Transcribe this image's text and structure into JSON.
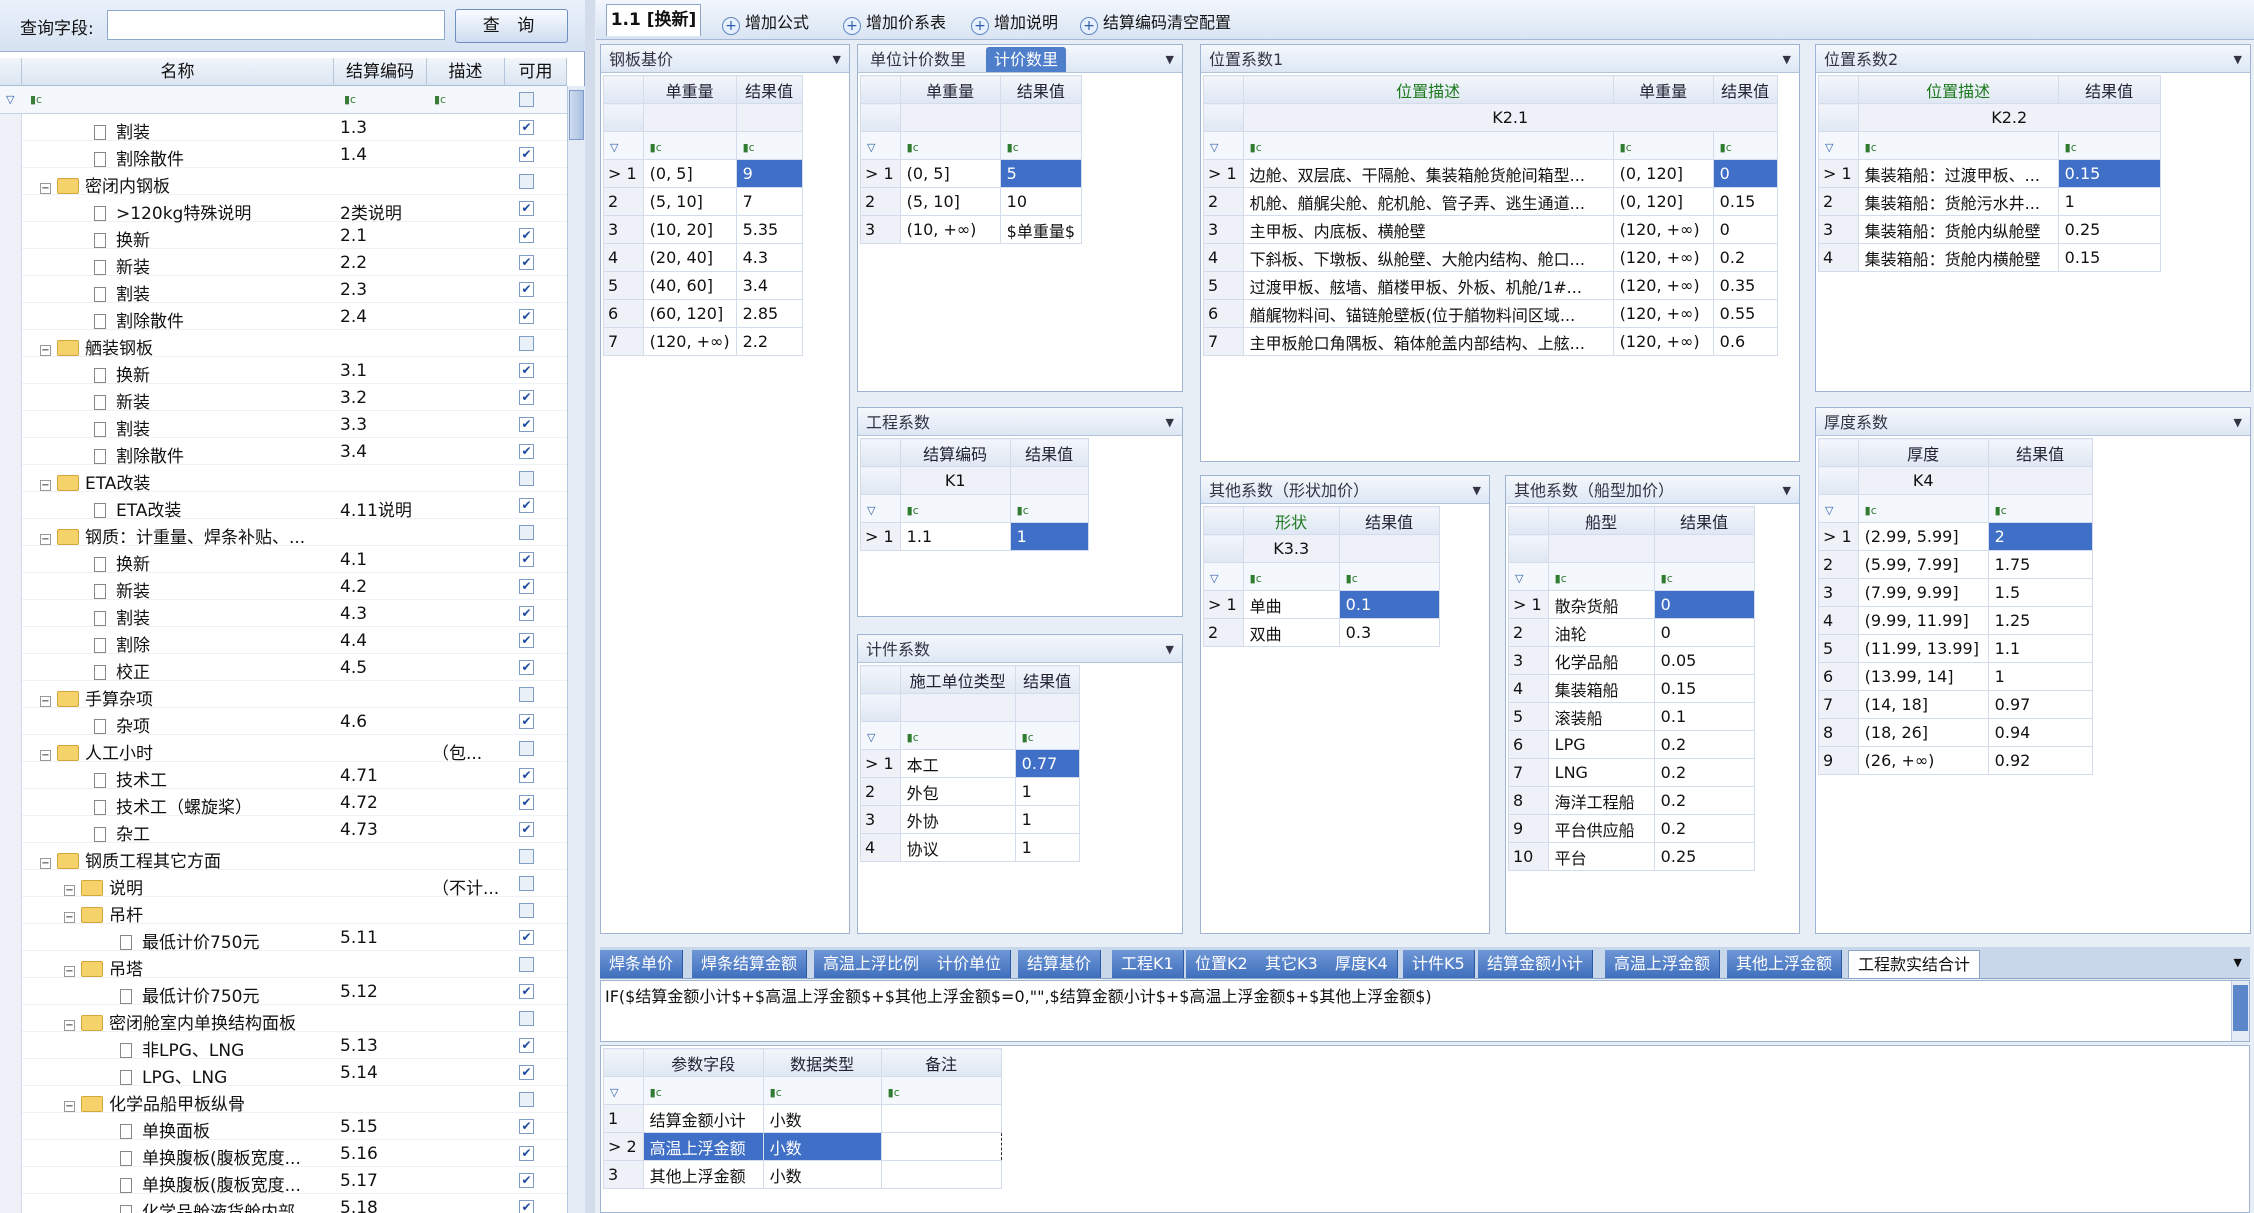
{
  "search": {
    "label": "查询字段:",
    "value": "",
    "button": "查 询"
  },
  "tree": {
    "columns": [
      "名称",
      "结算编码",
      "描述",
      "可用"
    ],
    "filter_icon": "filter-icon",
    "rows": [
      {
        "name": "割装",
        "code": "1.3",
        "desc": "",
        "level": 2,
        "type": "doc",
        "checked": true
      },
      {
        "name": "割除散件",
        "code": "1.4",
        "desc": "",
        "level": 2,
        "type": "doc",
        "checked": true
      },
      {
        "name": "密闭内钢板",
        "code": "",
        "desc": "",
        "level": 1,
        "type": "folder",
        "checked": false
      },
      {
        "name": ">120kg特殊说明",
        "code": "2类说明",
        "desc": "",
        "level": 2,
        "type": "doc",
        "checked": true
      },
      {
        "name": "换新",
        "code": "2.1",
        "desc": "",
        "level": 2,
        "type": "doc",
        "checked": true
      },
      {
        "name": "新装",
        "code": "2.2",
        "desc": "",
        "level": 2,
        "type": "doc",
        "checked": true
      },
      {
        "name": "割装",
        "code": "2.3",
        "desc": "",
        "level": 2,
        "type": "doc",
        "checked": true
      },
      {
        "name": "割除散件",
        "code": "2.4",
        "desc": "",
        "level": 2,
        "type": "doc",
        "checked": true
      },
      {
        "name": "舾装钢板",
        "code": "",
        "desc": "",
        "level": 1,
        "type": "folder",
        "checked": false
      },
      {
        "name": "换新",
        "code": "3.1",
        "desc": "",
        "level": 2,
        "type": "doc",
        "checked": true
      },
      {
        "name": "新装",
        "code": "3.2",
        "desc": "",
        "level": 2,
        "type": "doc",
        "checked": true
      },
      {
        "name": "割装",
        "code": "3.3",
        "desc": "",
        "level": 2,
        "type": "doc",
        "checked": true
      },
      {
        "name": "割除散件",
        "code": "3.4",
        "desc": "",
        "level": 2,
        "type": "doc",
        "checked": true
      },
      {
        "name": "ETA改装",
        "code": "",
        "desc": "",
        "level": 1,
        "type": "folder",
        "checked": false
      },
      {
        "name": "ETA改装",
        "code": "4.11说明",
        "desc": "",
        "level": 2,
        "type": "doc",
        "checked": true
      },
      {
        "name": "钢质：计重量、焊条补贴、...",
        "code": "",
        "desc": "",
        "level": 1,
        "type": "folder",
        "checked": false
      },
      {
        "name": "换新",
        "code": "4.1",
        "desc": "",
        "level": 2,
        "type": "doc",
        "checked": true
      },
      {
        "name": "新装",
        "code": "4.2",
        "desc": "",
        "level": 2,
        "type": "doc",
        "checked": true
      },
      {
        "name": "割装",
        "code": "4.3",
        "desc": "",
        "level": 2,
        "type": "doc",
        "checked": true
      },
      {
        "name": "割除",
        "code": "4.4",
        "desc": "",
        "level": 2,
        "type": "doc",
        "checked": true
      },
      {
        "name": "校正",
        "code": "4.5",
        "desc": "",
        "level": 2,
        "type": "doc",
        "checked": true
      },
      {
        "name": "手算杂项",
        "code": "",
        "desc": "",
        "level": 1,
        "type": "folder",
        "checked": false
      },
      {
        "name": "杂项",
        "code": "4.6",
        "desc": "",
        "level": 2,
        "type": "doc",
        "checked": true
      },
      {
        "name": "人工小时",
        "code": "",
        "desc": "（包...",
        "level": 1,
        "type": "folder",
        "checked": false
      },
      {
        "name": "技术工",
        "code": "4.71",
        "desc": "",
        "level": 2,
        "type": "doc",
        "checked": true
      },
      {
        "name": "技术工（螺旋桨）",
        "code": "4.72",
        "desc": "",
        "level": 2,
        "type": "doc",
        "checked": true
      },
      {
        "name": "杂工",
        "code": "4.73",
        "desc": "",
        "level": 2,
        "type": "doc",
        "checked": true
      },
      {
        "name": "钢质工程其它方面",
        "code": "",
        "desc": "",
        "level": 1,
        "type": "folder",
        "checked": false
      },
      {
        "name": "说明",
        "code": "",
        "desc": "（不计...",
        "level": 2,
        "type": "folder",
        "checked": false
      },
      {
        "name": "吊杆",
        "code": "",
        "desc": "",
        "level": 2,
        "type": "folder",
        "checked": false
      },
      {
        "name": "最低计价750元",
        "code": "5.11",
        "desc": "",
        "level": 3,
        "type": "doc",
        "checked": true
      },
      {
        "name": "吊塔",
        "code": "",
        "desc": "",
        "level": 2,
        "type": "folder",
        "checked": false
      },
      {
        "name": "最低计价750元",
        "code": "5.12",
        "desc": "",
        "level": 3,
        "type": "doc",
        "checked": true
      },
      {
        "name": "密闭舱室内单换结构面板",
        "code": "",
        "desc": "",
        "level": 2,
        "type": "folder",
        "checked": false
      },
      {
        "name": "非LPG、LNG",
        "code": "5.13",
        "desc": "",
        "level": 3,
        "type": "doc",
        "checked": true
      },
      {
        "name": "LPG、LNG",
        "code": "5.14",
        "desc": "",
        "level": 3,
        "type": "doc",
        "checked": true
      },
      {
        "name": "化学品船甲板纵骨",
        "code": "",
        "desc": "",
        "level": 2,
        "type": "folder",
        "checked": false
      },
      {
        "name": "单换面板",
        "code": "5.15",
        "desc": "",
        "level": 3,
        "type": "doc",
        "checked": true
      },
      {
        "name": "单换腹板(腹板宽度...",
        "code": "5.16",
        "desc": "",
        "level": 3,
        "type": "doc",
        "checked": true
      },
      {
        "name": "单换腹板(腹板宽度...",
        "code": "5.17",
        "desc": "",
        "level": 3,
        "type": "doc",
        "checked": true
      },
      {
        "name": "化学品舱液货舱内部...",
        "code": "5.18",
        "desc": "",
        "level": 3,
        "type": "doc",
        "checked": true
      }
    ]
  },
  "toolbar": {
    "active_tab": "1.1 [换新]",
    "buttons": [
      "增加公式",
      "增加价系表",
      "增加说明",
      "结算编码清空配置"
    ]
  },
  "panels": {
    "steel_base": {
      "title": "钢板基价",
      "headers": [
        "单重量",
        "结果值"
      ],
      "rows": [
        [
          "(0, 5]",
          "9"
        ],
        [
          "(5, 10]",
          "7"
        ],
        [
          "(10, 20]",
          "5.35"
        ],
        [
          "(20, 40]",
          "4.3"
        ],
        [
          "(40, 60]",
          "3.4"
        ],
        [
          "(60, 120]",
          "2.85"
        ],
        [
          "(120, +∞)",
          "2.2"
        ]
      ]
    },
    "unit_qty": {
      "tabs": [
        "单位计价数里",
        "计价数里"
      ],
      "headers": [
        "单重量",
        "结果值"
      ],
      "rows": [
        [
          "(0, 5]",
          "5"
        ],
        [
          "(5, 10]",
          "10"
        ],
        [
          "(10, +∞)",
          "$单重量$"
        ]
      ]
    },
    "pos1": {
      "title": "位置系数1",
      "headers": [
        "位置描述",
        "单重量",
        "结果值"
      ],
      "key": "K2.1",
      "rows": [
        [
          "边舱、双层底、干隔舱、集装箱舱货舱间箱型...",
          "(0, 120]",
          "0"
        ],
        [
          "机舱、艏艉尖舱、舵机舱、管子弄、逃生通道...",
          "(0, 120]",
          "0.15"
        ],
        [
          "主甲板、内底板、横舱壁",
          "(120, +∞)",
          "0"
        ],
        [
          "下斜板、下墩板、纵舱壁、大舱内结构、舱口...",
          "(120, +∞)",
          "0.2"
        ],
        [
          "过渡甲板、舷墙、艏楼甲板、外板、机舱/1#...",
          "(120, +∞)",
          "0.35"
        ],
        [
          "艏艉物料间、锚链舱壁板(位于艏物料间区域...",
          "(120, +∞)",
          "0.55"
        ],
        [
          "主甲板舱口角隅板、箱体舱盖内部结构、上舷...",
          "(120, +∞)",
          "0.6"
        ]
      ]
    },
    "pos2": {
      "title": "位置系数2",
      "headers": [
        "位置描述",
        "结果值"
      ],
      "key": "K2.2",
      "rows": [
        [
          "集装箱船：过渡甲板、...",
          "0.15"
        ],
        [
          "集装箱船：货舱污水井...",
          "1"
        ],
        [
          "集装箱船：货舱内纵舱壁",
          "0.25"
        ],
        [
          "集装箱船：货舱内横舱壁",
          "0.15"
        ]
      ]
    },
    "eng_coef": {
      "title": "工程系数",
      "headers": [
        "结算编码",
        "结果值"
      ],
      "key": "K1",
      "rows": [
        [
          "1.1",
          "1"
        ]
      ]
    },
    "pieces": {
      "title": "计件系数",
      "headers": [
        "施工单位类型",
        "结果值"
      ],
      "rows": [
        [
          "本工",
          "0.77"
        ],
        [
          "外包",
          "1"
        ],
        [
          "外协",
          "1"
        ],
        [
          "协议",
          "1"
        ]
      ]
    },
    "shape": {
      "title": "其他系数（形状加价）",
      "headers": [
        "形状",
        "结果值"
      ],
      "key": "K3.3",
      "rows": [
        [
          "单曲",
          "0.1"
        ],
        [
          "双曲",
          "0.3"
        ]
      ]
    },
    "shiptype": {
      "title": "其他系数（船型加价）",
      "headers": [
        "船型",
        "结果值"
      ],
      "rows": [
        [
          "散杂货船",
          "0"
        ],
        [
          "油轮",
          "0"
        ],
        [
          "化学品船",
          "0.05"
        ],
        [
          "集装箱船",
          "0.15"
        ],
        [
          "滚装船",
          "0.1"
        ],
        [
          "LPG",
          "0.2"
        ],
        [
          "LNG",
          "0.2"
        ],
        [
          "海洋工程船",
          "0.2"
        ],
        [
          "平台供应船",
          "0.2"
        ],
        [
          "平台",
          "0.25"
        ]
      ]
    },
    "thickness": {
      "title": "厚度系数",
      "headers": [
        "厚度",
        "结果值"
      ],
      "key": "K4",
      "rows": [
        [
          "(2.99, 5.99]",
          "2"
        ],
        [
          "(5.99, 7.99]",
          "1.75"
        ],
        [
          "(7.99, 9.99]",
          "1.5"
        ],
        [
          "(9.99, 11.99]",
          "1.25"
        ],
        [
          "(11.99, 13.99]",
          "1.1"
        ],
        [
          "(13.99, 14]",
          "1"
        ],
        [
          "(14, 18]",
          "0.97"
        ],
        [
          "(18, 26]",
          "0.94"
        ],
        [
          "(26, +∞)",
          "0.92"
        ]
      ]
    }
  },
  "bottom": {
    "tabs": [
      "焊条单价",
      "焊条结算金额",
      "高温上浮比例",
      "计价单位",
      "结算基价",
      "工程K1",
      "位置K2",
      "其它K3",
      "厚度K4",
      "计件K5",
      "结算金额小计",
      "高温上浮金额",
      "其他上浮金额",
      "工程款实结合计"
    ],
    "active_tab": "工程款实结合计",
    "formula": "IF($结算金额小计$+$高温上浮金额$+$其他上浮金额$=0,\"\",$结算金额小计$+$高温上浮金额$+$其他上浮金额$)",
    "param_headers": [
      "参数字段",
      "数据类型",
      "备注"
    ],
    "params": [
      [
        "结算金额小计",
        "小数",
        ""
      ],
      [
        "高温上浮金额",
        "小数",
        ""
      ],
      [
        "其他上浮金额",
        "小数",
        ""
      ]
    ]
  },
  "colors": {
    "accent": "#3f6fc6",
    "header_bg": "#dfe7f3"
  }
}
